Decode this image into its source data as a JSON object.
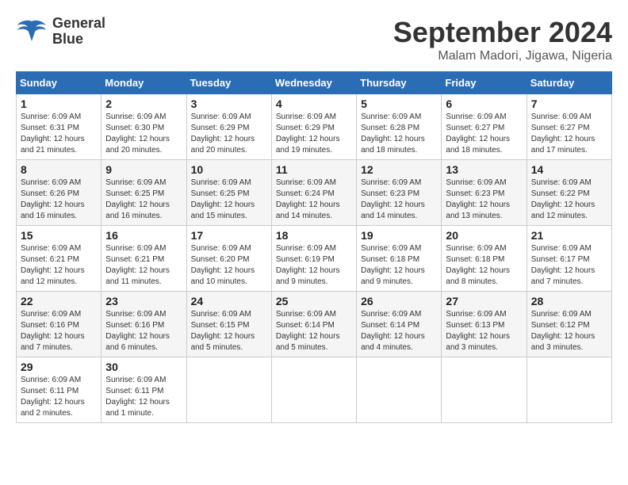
{
  "logo": {
    "line1": "General",
    "line2": "Blue"
  },
  "header": {
    "month": "September 2024",
    "location": "Malam Madori, Jigawa, Nigeria"
  },
  "weekdays": [
    "Sunday",
    "Monday",
    "Tuesday",
    "Wednesday",
    "Thursday",
    "Friday",
    "Saturday"
  ],
  "weeks": [
    [
      {
        "day": "1",
        "sunrise": "6:09 AM",
        "sunset": "6:31 PM",
        "daylight": "12 hours and 21 minutes."
      },
      {
        "day": "2",
        "sunrise": "6:09 AM",
        "sunset": "6:30 PM",
        "daylight": "12 hours and 20 minutes."
      },
      {
        "day": "3",
        "sunrise": "6:09 AM",
        "sunset": "6:29 PM",
        "daylight": "12 hours and 20 minutes."
      },
      {
        "day": "4",
        "sunrise": "6:09 AM",
        "sunset": "6:29 PM",
        "daylight": "12 hours and 19 minutes."
      },
      {
        "day": "5",
        "sunrise": "6:09 AM",
        "sunset": "6:28 PM",
        "daylight": "12 hours and 18 minutes."
      },
      {
        "day": "6",
        "sunrise": "6:09 AM",
        "sunset": "6:27 PM",
        "daylight": "12 hours and 18 minutes."
      },
      {
        "day": "7",
        "sunrise": "6:09 AM",
        "sunset": "6:27 PM",
        "daylight": "12 hours and 17 minutes."
      }
    ],
    [
      {
        "day": "8",
        "sunrise": "6:09 AM",
        "sunset": "6:26 PM",
        "daylight": "12 hours and 16 minutes."
      },
      {
        "day": "9",
        "sunrise": "6:09 AM",
        "sunset": "6:25 PM",
        "daylight": "12 hours and 16 minutes."
      },
      {
        "day": "10",
        "sunrise": "6:09 AM",
        "sunset": "6:25 PM",
        "daylight": "12 hours and 15 minutes."
      },
      {
        "day": "11",
        "sunrise": "6:09 AM",
        "sunset": "6:24 PM",
        "daylight": "12 hours and 14 minutes."
      },
      {
        "day": "12",
        "sunrise": "6:09 AM",
        "sunset": "6:23 PM",
        "daylight": "12 hours and 14 minutes."
      },
      {
        "day": "13",
        "sunrise": "6:09 AM",
        "sunset": "6:23 PM",
        "daylight": "12 hours and 13 minutes."
      },
      {
        "day": "14",
        "sunrise": "6:09 AM",
        "sunset": "6:22 PM",
        "daylight": "12 hours and 12 minutes."
      }
    ],
    [
      {
        "day": "15",
        "sunrise": "6:09 AM",
        "sunset": "6:21 PM",
        "daylight": "12 hours and 12 minutes."
      },
      {
        "day": "16",
        "sunrise": "6:09 AM",
        "sunset": "6:21 PM",
        "daylight": "12 hours and 11 minutes."
      },
      {
        "day": "17",
        "sunrise": "6:09 AM",
        "sunset": "6:20 PM",
        "daylight": "12 hours and 10 minutes."
      },
      {
        "day": "18",
        "sunrise": "6:09 AM",
        "sunset": "6:19 PM",
        "daylight": "12 hours and 9 minutes."
      },
      {
        "day": "19",
        "sunrise": "6:09 AM",
        "sunset": "6:18 PM",
        "daylight": "12 hours and 9 minutes."
      },
      {
        "day": "20",
        "sunrise": "6:09 AM",
        "sunset": "6:18 PM",
        "daylight": "12 hours and 8 minutes."
      },
      {
        "day": "21",
        "sunrise": "6:09 AM",
        "sunset": "6:17 PM",
        "daylight": "12 hours and 7 minutes."
      }
    ],
    [
      {
        "day": "22",
        "sunrise": "6:09 AM",
        "sunset": "6:16 PM",
        "daylight": "12 hours and 7 minutes."
      },
      {
        "day": "23",
        "sunrise": "6:09 AM",
        "sunset": "6:16 PM",
        "daylight": "12 hours and 6 minutes."
      },
      {
        "day": "24",
        "sunrise": "6:09 AM",
        "sunset": "6:15 PM",
        "daylight": "12 hours and 5 minutes."
      },
      {
        "day": "25",
        "sunrise": "6:09 AM",
        "sunset": "6:14 PM",
        "daylight": "12 hours and 5 minutes."
      },
      {
        "day": "26",
        "sunrise": "6:09 AM",
        "sunset": "6:14 PM",
        "daylight": "12 hours and 4 minutes."
      },
      {
        "day": "27",
        "sunrise": "6:09 AM",
        "sunset": "6:13 PM",
        "daylight": "12 hours and 3 minutes."
      },
      {
        "day": "28",
        "sunrise": "6:09 AM",
        "sunset": "6:12 PM",
        "daylight": "12 hours and 3 minutes."
      }
    ],
    [
      {
        "day": "29",
        "sunrise": "6:09 AM",
        "sunset": "6:11 PM",
        "daylight": "12 hours and 2 minutes."
      },
      {
        "day": "30",
        "sunrise": "6:09 AM",
        "sunset": "6:11 PM",
        "daylight": "12 hours and 1 minute."
      },
      null,
      null,
      null,
      null,
      null
    ]
  ]
}
